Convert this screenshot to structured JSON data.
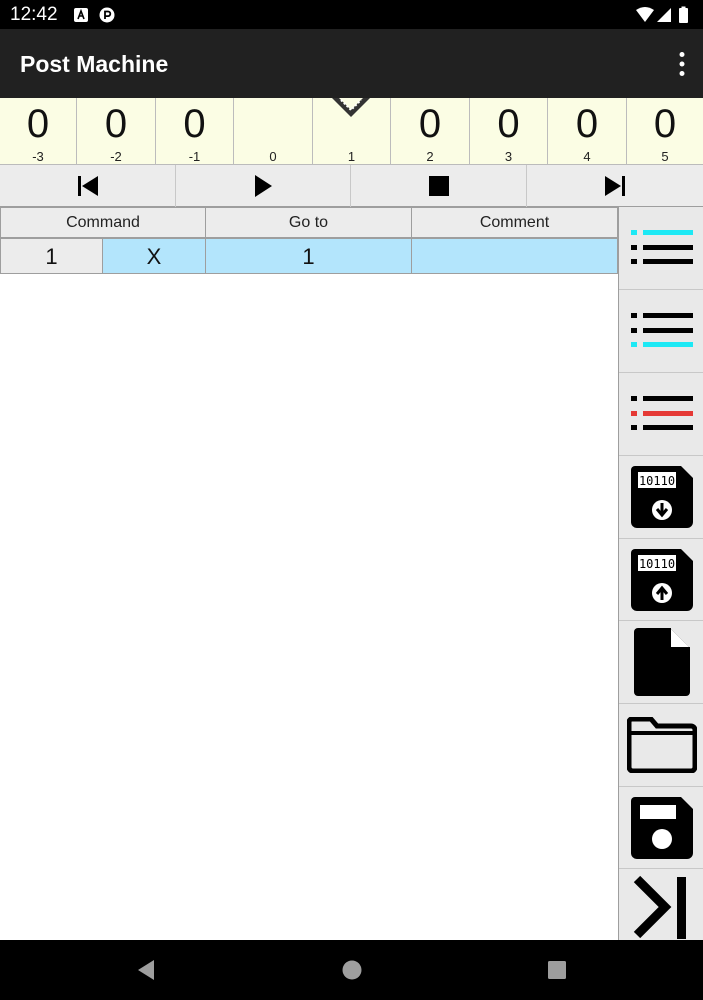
{
  "status_bar": {
    "time": "12:42",
    "icons": [
      "notification-a-icon",
      "notification-p-icon",
      "wifi-icon",
      "signal-icon",
      "battery-icon"
    ]
  },
  "app_bar": {
    "title": "Post Machine",
    "menu_icon": "overflow-menu-icon"
  },
  "tape": {
    "head_position": 1,
    "cells": [
      {
        "index": "-3",
        "value": "0"
      },
      {
        "index": "-2",
        "value": "0"
      },
      {
        "index": "-1",
        "value": "0"
      },
      {
        "index": "0",
        "value": ""
      },
      {
        "index": "1",
        "value": ""
      },
      {
        "index": "2",
        "value": "0"
      },
      {
        "index": "3",
        "value": "0"
      },
      {
        "index": "4",
        "value": "0"
      },
      {
        "index": "5",
        "value": "0"
      }
    ]
  },
  "controls": [
    "skip-to-start-icon",
    "play-icon",
    "stop-icon",
    "step-forward-icon"
  ],
  "table": {
    "headers": {
      "command": "Command",
      "goto": "Go to",
      "comment": "Comment"
    },
    "rows": [
      {
        "number": "1",
        "command": "X",
        "goto": "1",
        "comment": ""
      }
    ],
    "selected_color": "#b3e5fc"
  },
  "sidebar": {
    "buttons": [
      "insert-row-above-icon",
      "insert-row-below-icon",
      "delete-row-icon",
      "save-to-device-icon",
      "load-from-device-icon",
      "new-file-icon",
      "open-folder-icon",
      "save-icon",
      "step-end-icon"
    ],
    "accent_cyan": "#1de9f5",
    "accent_red": "#e53935"
  },
  "nav_bar": {
    "icons": [
      "back-icon",
      "home-icon",
      "recents-icon"
    ]
  }
}
